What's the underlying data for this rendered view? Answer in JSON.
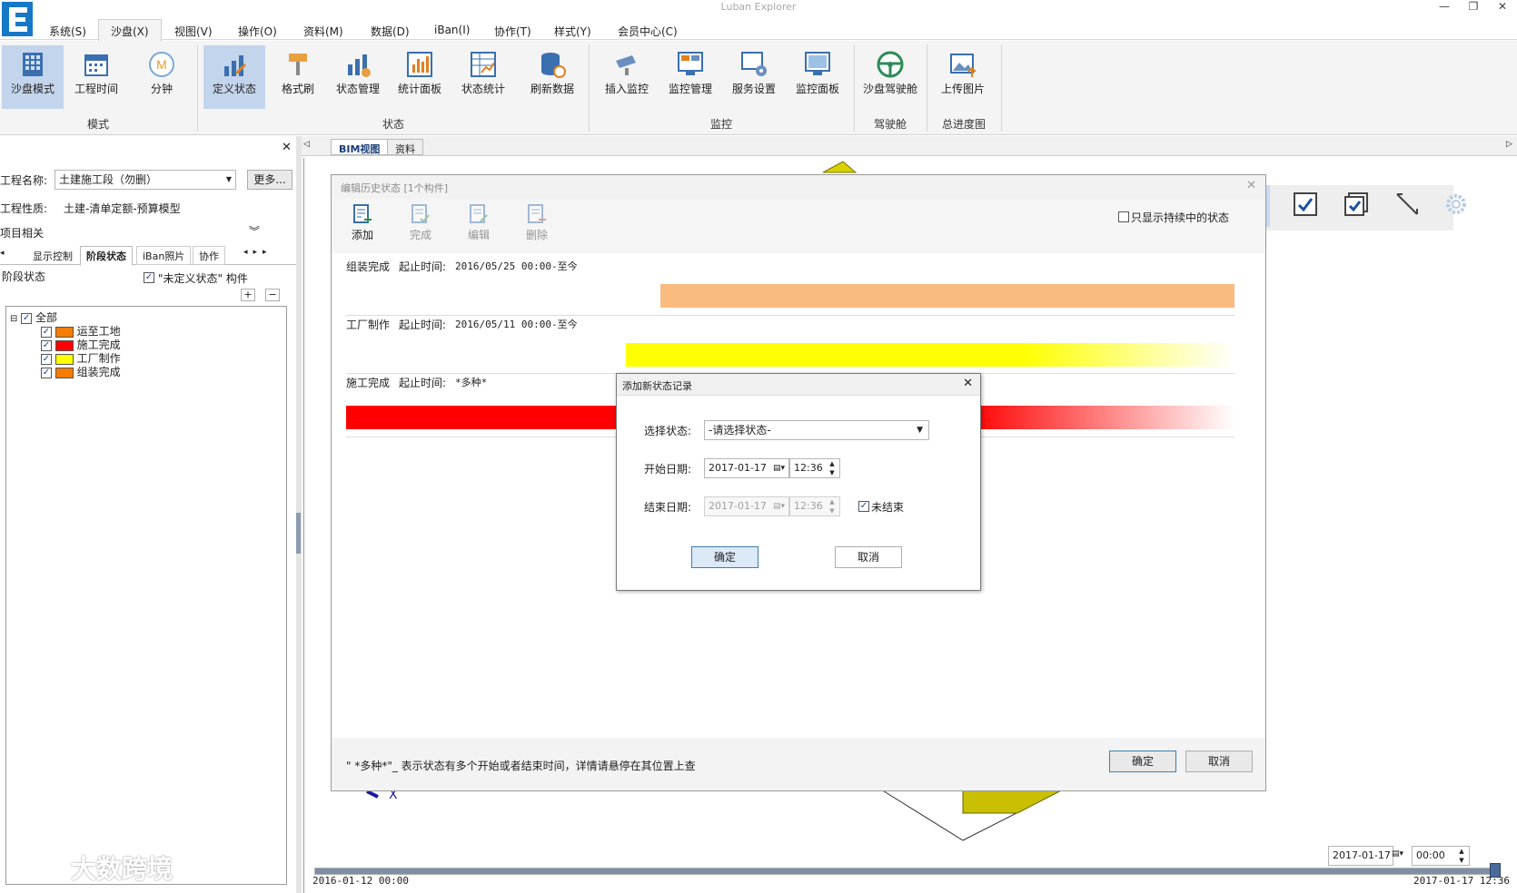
{
  "app": {
    "title": "Luban Explorer"
  },
  "menu": [
    "系统(S)",
    "沙盘(X)",
    "视图(V)",
    "操作(O)",
    "资料(M)",
    "数据(D)",
    "iBan(I)",
    "协作(T)",
    "样式(Y)",
    "会员中心(C)"
  ],
  "ribbon": {
    "buttons": [
      "沙盘模式",
      "工程时间",
      "分钟",
      "定义状态",
      "格式刷",
      "状态管理",
      "统计面板",
      "状态统计",
      "刷新数据",
      "插入监控",
      "监控管理",
      "服务设置",
      "监控面板",
      "沙盘驾驶舱",
      "上传图片"
    ],
    "groups": [
      "模式",
      "状态",
      "监控",
      "驾驶舱",
      "总进度图"
    ]
  },
  "left": {
    "project_label": "工程名称:",
    "project_value": "土建施工段（勿删）",
    "more_button": "更多...",
    "nature_label": "工程性质:",
    "nature_value": "土建-清单定额-预算模型",
    "related_label": "项目相关",
    "tabs": [
      "显示控制",
      "阶段状态",
      "iBan照片",
      "协作"
    ],
    "stage_label": "阶段状态",
    "undefined_check": "\"未定义状态\" 构件",
    "plus": "+",
    "minus": "−",
    "tree_root": "全部",
    "tree_items": [
      {
        "label": "运至工地",
        "color": "#f57c00"
      },
      {
        "label": "施工完成",
        "color": "#ff0000"
      },
      {
        "label": "工厂制作",
        "color": "#ffff00"
      },
      {
        "label": "组装完成",
        "color": "#f57c00"
      }
    ]
  },
  "doc_tabs": [
    "BIM视图",
    "资料"
  ],
  "history_dialog": {
    "title": "编辑历史状态 [1个构件]",
    "tools": [
      "添加",
      "完成",
      "编辑",
      "删除"
    ],
    "only_continuing": "只显示持续中的状态",
    "records": [
      {
        "name": "组装完成",
        "time_label": "起止时间:",
        "time": "2016/05/25 00:00-至今",
        "color": "#f9bb7f"
      },
      {
        "name": "工厂制作",
        "time_label": "起止时间:",
        "time": "2016/05/11 00:00-至今",
        "color": "#ffff00"
      },
      {
        "name": "施工完成",
        "time_label": "起止时间:",
        "time": "*多种*",
        "color": "#ff0000"
      }
    ],
    "footnote": "\" *多种*\"_ 表示状态有多个开始或者结束时间，详情请悬停在其位置上查",
    "ok": "确定",
    "cancel": "取消"
  },
  "add_dialog": {
    "title": "添加新状态记录",
    "state_label": "选择状态:",
    "state_value": "-请选择状态-",
    "start_label": "开始日期:",
    "start_date": "2017-01-17",
    "start_time": "12:36",
    "end_label": "结束日期:",
    "end_date": "2017-01-17",
    "end_time": "12:36",
    "not_ended": "未结束",
    "ok": "确定",
    "cancel": "取消"
  },
  "timeline": {
    "date": "2017-01-17",
    "time": "00:00",
    "start": "2016-01-12 00:00",
    "end": "2017-01-17 12:36"
  },
  "axis_label": "X",
  "watermark": "大数跨境"
}
